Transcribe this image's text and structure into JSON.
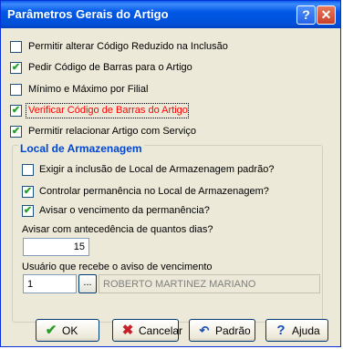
{
  "window": {
    "title": "Parâmetros Gerais do Artigo",
    "help_glyph": "?",
    "close_glyph": "✕"
  },
  "options": [
    {
      "label": "Permitir alterar Código Reduzido na Inclusão",
      "checked": false
    },
    {
      "label": "Pedir Código de Barras para o Artigo",
      "checked": true
    },
    {
      "label": "Mínimo e Máximo por Filial",
      "checked": false
    },
    {
      "label": "Verificar Código de Barras do Artigo",
      "checked": true,
      "color": "#ff0000"
    },
    {
      "label": "Permitir relacionar Artigo com Serviço",
      "checked": true
    }
  ],
  "storage": {
    "group_title": "Local de Armazenagem",
    "options": [
      {
        "label": "Exigir a inclusão de Local de Armazenagem padrão?",
        "checked": false
      },
      {
        "label": "Controlar permanência no Local de Armazenagem?",
        "checked": true
      },
      {
        "label": "Avisar o vencimento da permanência?",
        "checked": true
      }
    ],
    "days_label": "Avisar com antecedência de quantos dias?",
    "days_value": "15",
    "user_label": "Usuário que recebe o aviso de vencimento",
    "user_code": "1",
    "lookup_label": "...",
    "user_name": "ROBERTO MARTINEZ MARIANO"
  },
  "buttons": {
    "ok": {
      "label": "OK",
      "icon": "check-icon",
      "color": "#2a9d2a"
    },
    "cancel": {
      "label": "Cancelar",
      "icon": "x-icon",
      "color": "#c8202a"
    },
    "default": {
      "label": "Padrão",
      "icon": "undo-arrow-icon",
      "color": "#1a4fb8"
    },
    "help": {
      "label": "Ajuda",
      "icon": "question-icon",
      "color": "#1a4fb8"
    }
  },
  "check_glyph": "✔"
}
